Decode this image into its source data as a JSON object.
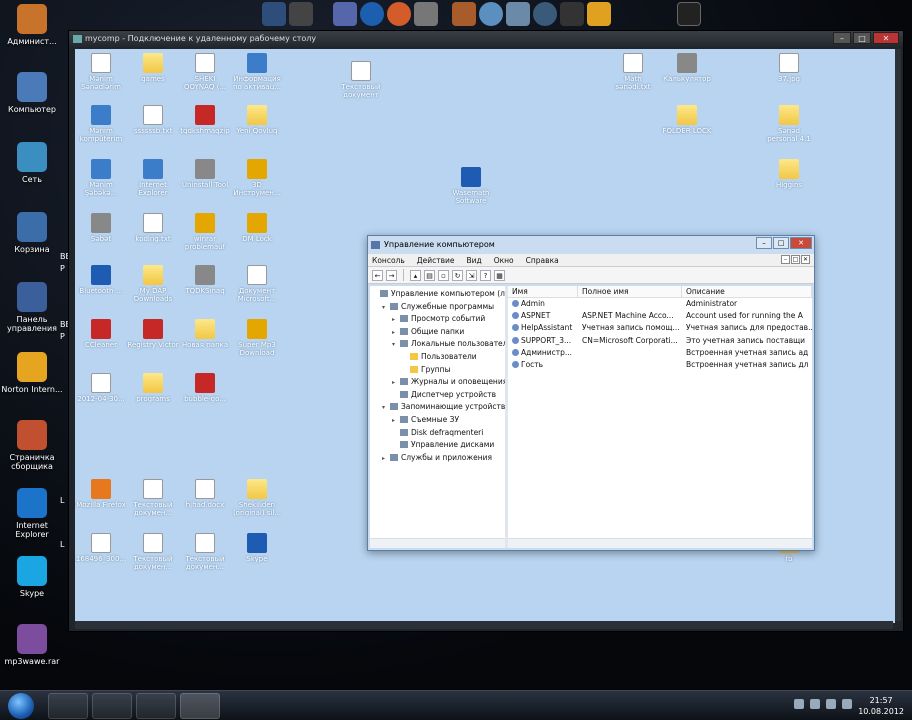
{
  "local_desktop": {
    "icons": [
      {
        "label": "Админист...",
        "icon": "user-icon",
        "color": "#c8732c"
      },
      {
        "label": "Компьютер",
        "icon": "computer-icon",
        "color": "#4a7ab8"
      },
      {
        "label": "Сеть",
        "icon": "network-icon",
        "color": "#3a8fc0"
      },
      {
        "label": "Корзина",
        "icon": "recycle-bin-icon",
        "color": "#3b6ea8"
      },
      {
        "label": "Панель управления",
        "icon": "control-panel-icon",
        "color": "#3a5f9a"
      },
      {
        "label": "Norton Intern...",
        "icon": "norton-icon",
        "color": "#e6a520"
      },
      {
        "label": "Страничка сборщика",
        "icon": "browser-icon",
        "color": "#c05030"
      },
      {
        "label": "Internet Explorer",
        "icon": "ie-icon",
        "color": "#1b74c9"
      },
      {
        "label": "Skype",
        "icon": "skype-icon",
        "color": "#1aa5e3"
      },
      {
        "label": "mp3wawe.rar",
        "icon": "winrar-icon",
        "color": "#7c4d9c"
      }
    ],
    "partial_labels": [
      "BE",
      "P",
      "BE",
      "P",
      "L",
      "L"
    ]
  },
  "rdp_window": {
    "title": "mycomp - Подключение к удаленному рабочему столу",
    "controls": [
      "–",
      "□",
      "✕"
    ]
  },
  "remote_desktop": {
    "icons": [
      {
        "label": "Mənim Sənədlərim",
        "icon": "doc-icon",
        "type": "doc"
      },
      {
        "label": "games",
        "icon": "folder-icon",
        "type": "folder"
      },
      {
        "label": "SHEKI QOYNAQ (...",
        "icon": "doc-icon",
        "type": "doc"
      },
      {
        "label": "Информация по активац...",
        "icon": "ie-icon",
        "type": "app"
      },
      {
        "label": "Текстовый документ",
        "icon": "doc-icon",
        "type": "doc"
      },
      {
        "label": "Math sənədi.txt",
        "icon": "doc-icon",
        "type": "doc"
      },
      {
        "label": "Калькулятор",
        "icon": "calculator-icon",
        "type": "gray"
      },
      {
        "label": "37.jpg",
        "icon": "image-icon",
        "type": "doc"
      },
      {
        "label": "Mənim kompüterim",
        "icon": "computer-icon",
        "type": "app"
      },
      {
        "label": "ssssssb.txt",
        "icon": "doc-icon",
        "type": "doc"
      },
      {
        "label": "tqdkshmaqzip",
        "icon": "archive-icon",
        "type": "red"
      },
      {
        "label": "Yeni Qovluq",
        "icon": "folder-icon",
        "type": "folder"
      },
      {
        "label": "FOLDER LOCK",
        "icon": "folder-icon",
        "type": "folder"
      },
      {
        "label": "Sənəd personal 4.1",
        "icon": "folder-icon",
        "type": "folder"
      },
      {
        "label": "Mənim Şəbəkə...",
        "icon": "network-icon",
        "type": "app"
      },
      {
        "label": "Internet Explorer",
        "icon": "ie-icon",
        "type": "app"
      },
      {
        "label": "Uninstall Tool",
        "icon": "uninstall-icon",
        "type": "gray"
      },
      {
        "label": "3D Инструмен...",
        "icon": "3d-icon",
        "type": "gold"
      },
      {
        "label": "Wasemath Software",
        "icon": "software-icon",
        "type": "blue"
      },
      {
        "label": "Higgins",
        "icon": "folder-icon",
        "type": "folder"
      },
      {
        "label": "Səbət",
        "icon": "recycle-bin-icon",
        "type": "gray"
      },
      {
        "label": "kodlng.txt",
        "icon": "doc-icon",
        "type": "doc"
      },
      {
        "label": "winrar problemauf",
        "icon": "winrar-icon",
        "type": "gold"
      },
      {
        "label": "DM Lock",
        "icon": "lock-icon",
        "type": "gold"
      },
      {
        "label": "Bluetooth-...",
        "icon": "bluetooth-icon",
        "type": "blue"
      },
      {
        "label": "My DAP Downloads",
        "icon": "folder-icon",
        "type": "folder"
      },
      {
        "label": "TQDKSınaq",
        "icon": "app-icon",
        "type": "gray"
      },
      {
        "label": "Документ Microsoft...",
        "icon": "word-icon",
        "type": "doc"
      },
      {
        "label": "CCleaner",
        "icon": "ccleaner-icon",
        "type": "red"
      },
      {
        "label": "Registry Victor",
        "icon": "registry-icon",
        "type": "red"
      },
      {
        "label": "Новая папка",
        "icon": "folder-icon",
        "type": "folder"
      },
      {
        "label": "Super Mp3 Download",
        "icon": "music-icon",
        "type": "gold"
      },
      {
        "label": "2012-04-30...",
        "icon": "image-icon",
        "type": "doc"
      },
      {
        "label": "programs",
        "icon": "folder-icon",
        "type": "folder"
      },
      {
        "label": "bubble-go...",
        "icon": "game-icon",
        "type": "red"
      },
      {
        "label": "Mozilla Firefox",
        "icon": "firefox-icon",
        "type": "orange"
      },
      {
        "label": "Текстовый докумен...",
        "icon": "doc-icon",
        "type": "doc"
      },
      {
        "label": "hjhad.docx",
        "icon": "word-icon",
        "type": "doc"
      },
      {
        "label": "Shekiliden (original) sil...",
        "icon": "folder-icon",
        "type": "folder"
      },
      {
        "label": "168496_300...",
        "icon": "image-icon",
        "type": "doc"
      },
      {
        "label": "Текстовый докумен...",
        "icon": "doc-icon",
        "type": "doc"
      },
      {
        "label": "Текстовый докумен...",
        "icon": "doc-icon",
        "type": "doc"
      },
      {
        "label": "Skype",
        "icon": "skype-icon",
        "type": "blue"
      },
      {
        "label": "fb",
        "icon": "folder-icon",
        "type": "folder"
      }
    ]
  },
  "computer_management": {
    "title": "Управление компьютером",
    "menu": [
      "Консоль",
      "Действие",
      "Вид",
      "Окно",
      "Справка"
    ],
    "tree": [
      {
        "label": "Управление компьютером (лок",
        "level": 0,
        "exp": "",
        "icon": "computer-icon"
      },
      {
        "label": "Служебные программы",
        "level": 1,
        "exp": "▾",
        "icon": "tools-icon"
      },
      {
        "label": "Просмотр событий",
        "level": 2,
        "exp": "▸",
        "icon": "event-viewer-icon"
      },
      {
        "label": "Общие папки",
        "level": 2,
        "exp": "▸",
        "icon": "shared-folder-icon"
      },
      {
        "label": "Локальные пользовател",
        "level": 2,
        "exp": "▾",
        "icon": "users-icon"
      },
      {
        "label": "Пользователи",
        "level": 3,
        "exp": "",
        "icon": "folder-icon"
      },
      {
        "label": "Группы",
        "level": 3,
        "exp": "",
        "icon": "folder-icon"
      },
      {
        "label": "Журналы и оповещения",
        "level": 2,
        "exp": "▸",
        "icon": "logs-icon"
      },
      {
        "label": "Диспетчер устройств",
        "level": 2,
        "exp": "",
        "icon": "device-manager-icon"
      },
      {
        "label": "Запоминающие устройства",
        "level": 1,
        "exp": "▾",
        "icon": "storage-icon"
      },
      {
        "label": "Съемные ЗУ",
        "level": 2,
        "exp": "▸",
        "icon": "removable-storage-icon"
      },
      {
        "label": "Disk defraqmenteri",
        "level": 2,
        "exp": "",
        "icon": "defrag-icon"
      },
      {
        "label": "Управление дисками",
        "level": 2,
        "exp": "",
        "icon": "disk-management-icon"
      },
      {
        "label": "Службы и приложения",
        "level": 1,
        "exp": "▸",
        "icon": "services-icon"
      }
    ],
    "columns": [
      "Имя",
      "Полное имя",
      "Описание"
    ],
    "rows": [
      {
        "name": "Admin",
        "full_name": "",
        "description": "Administrator"
      },
      {
        "name": "ASPNET",
        "full_name": "ASP.NET Machine Acco...",
        "description": "Account used for running the A"
      },
      {
        "name": "HelpAssistant",
        "full_name": "Учетная запись помощ...",
        "description": "Учетная запись для предостав..."
      },
      {
        "name": "SUPPORT_3...",
        "full_name": "CN=Microsoft Corporati...",
        "description": "Это учетная запись поставщи"
      },
      {
        "name": "Администр...",
        "full_name": "",
        "description": "Встроенная учетная запись ад"
      },
      {
        "name": "Гость",
        "full_name": "",
        "description": "Встроенная учетная запись дл"
      }
    ]
  },
  "taskbar": {
    "time": "21:57",
    "date": "10.08.2012"
  }
}
